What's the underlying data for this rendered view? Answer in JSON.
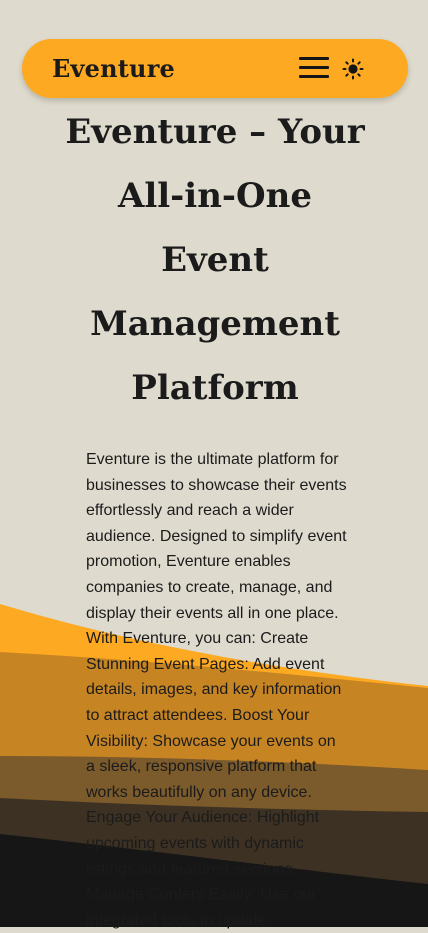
{
  "navbar": {
    "brand": "Eventure",
    "menu_icon": "hamburger-menu-icon",
    "theme_icon": "sun-icon"
  },
  "hero": {
    "title": "Eventure – Your All-in-One Event Management Platform",
    "description": "Eventure is the ultimate platform for businesses to showcase their events effortlessly and reach a wider audience. Designed to simplify event promotion, Eventure enables companies to create, manage, and display their events all in one place. With Eventure, you can: Create Stunning Event Pages: Add event details, images, and key information to attract attendees. Boost Your Visibility: Showcase your events on a sleek, responsive platform that works beautifully on any device. Engage Your Audience: Highlight upcoming events with dynamic listings and featured sections. Manage Content Easily: Use our integrated tools to update"
  },
  "colors": {
    "background": "#dedacd",
    "accent": "#fea922",
    "text": "#1b1b1b",
    "wave_1": "#fea922",
    "wave_2": "#c78423",
    "wave_3": "#7b5a2b",
    "wave_4": "#3d3123",
    "wave_5": "#161617"
  }
}
